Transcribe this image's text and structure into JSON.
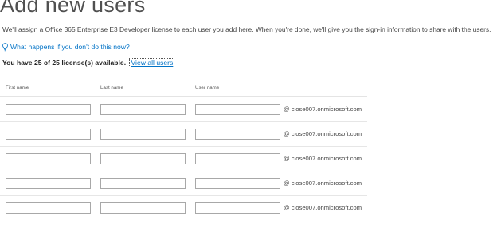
{
  "page": {
    "title": "Add new users",
    "intro": "We'll assign a Office 365 Enterprise E3 Developer license to each user you add here. When you're done, we'll give you the sign-in information to share with the users.",
    "help_link": "What happens if you don't do this now?",
    "help_icon": "lightbulb-icon",
    "license_text": "You have 25 of 25 license(s) available.",
    "view_all_link": "View all users"
  },
  "form": {
    "columns": [
      "First name",
      "Last name",
      "User name"
    ],
    "rows": [
      {
        "first_name": "",
        "last_name": "",
        "user_name": "",
        "domain": "@ close007.onmicrosoft.com"
      },
      {
        "first_name": "",
        "last_name": "",
        "user_name": "",
        "domain": "@ close007.onmicrosoft.com"
      },
      {
        "first_name": "",
        "last_name": "",
        "user_name": "",
        "domain": "@ close007.onmicrosoft.com"
      },
      {
        "first_name": "",
        "last_name": "",
        "user_name": "",
        "domain": "@ close007.onmicrosoft.com"
      },
      {
        "first_name": "",
        "last_name": "",
        "user_name": "",
        "domain": "@ close007.onmicrosoft.com"
      }
    ]
  },
  "colors": {
    "link": "#0072c6",
    "field_border": "#a8a8a8",
    "title": "#505050"
  }
}
